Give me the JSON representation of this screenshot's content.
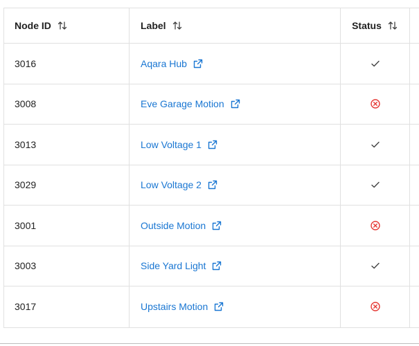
{
  "table": {
    "headers": {
      "node_id": "Node ID",
      "label": "Label",
      "status": "Status"
    },
    "rows": [
      {
        "node_id": "3016",
        "label": "Aqara Hub",
        "status": "ok"
      },
      {
        "node_id": "3008",
        "label": "Eve Garage Motion",
        "status": "error"
      },
      {
        "node_id": "3013",
        "label": "Low Voltage 1",
        "status": "ok"
      },
      {
        "node_id": "3029",
        "label": "Low Voltage 2",
        "status": "ok"
      },
      {
        "node_id": "3001",
        "label": "Outside Motion",
        "status": "error"
      },
      {
        "node_id": "3003",
        "label": "Side Yard Light",
        "status": "ok"
      },
      {
        "node_id": "3017",
        "label": "Upstairs Motion",
        "status": "error"
      }
    ]
  },
  "colors": {
    "link": "#1976d2",
    "ok": "#424242",
    "error": "#e53935",
    "border": "#e0e0e0"
  },
  "icons": {
    "sort": "sort-arrows-icon",
    "external": "external-link-icon",
    "ok": "check-icon",
    "error": "error-circle-icon"
  }
}
